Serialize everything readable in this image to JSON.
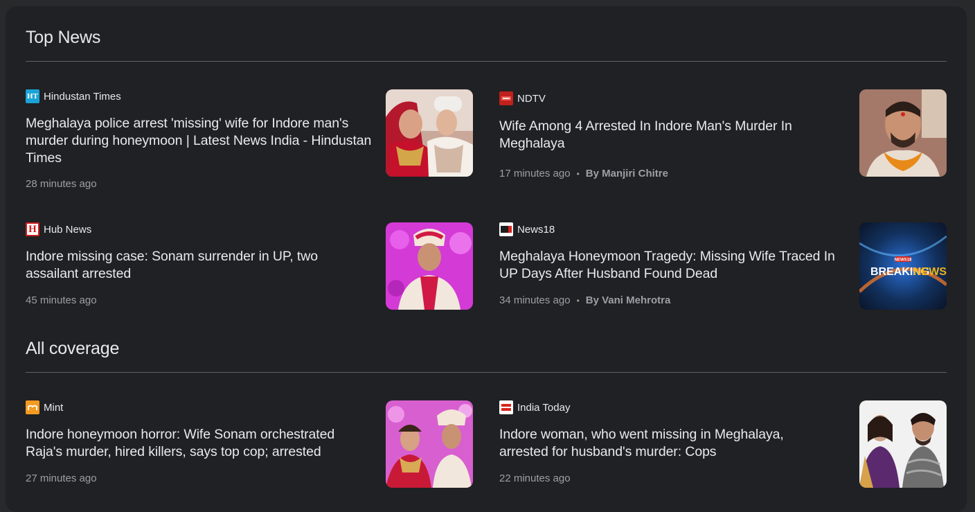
{
  "sections": {
    "top_news": {
      "title": "Top News"
    },
    "all_coverage": {
      "title": "All coverage"
    }
  },
  "articles": [
    {
      "source": "Hindustan Times",
      "favicon": "ht-icon",
      "headline": "Meghalaya police arrest 'missing' wife for Indore man's murder during honeymoon | Latest News India - Hindustan Times",
      "time": "28 minutes ago",
      "author": ""
    },
    {
      "source": "NDTV",
      "favicon": "ndtv-icon",
      "headline": "Wife Among 4 Arrested In Indore Man's Murder In Meghalaya",
      "time": "17 minutes ago",
      "author": "By Manjiri Chitre"
    },
    {
      "source": "Hub News",
      "favicon": "hub-news-icon",
      "headline": "Indore missing case: Sonam surrender in UP, two assailant arrested",
      "time": "45 minutes ago",
      "author": ""
    },
    {
      "source": "News18",
      "favicon": "news18-icon",
      "headline": "Meghalaya Honeymoon Tragedy: Missing Wife Traced In UP Days After Husband Found Dead",
      "time": "34 minutes ago",
      "author": "By Vani Mehrotra",
      "thumb_text": {
        "line1": "BREAKING",
        "line2": "NEWS",
        "badge": "NEWS18"
      }
    },
    {
      "source": "Mint",
      "favicon": "mint-icon",
      "headline": "Indore honeymoon horror: Wife Sonam orchestrated Raja's murder, hired killers, says top cop; arrested",
      "time": "27 minutes ago",
      "author": ""
    },
    {
      "source": "India Today",
      "favicon": "india-today-icon",
      "headline": "Indore woman, who went missing in Meghalaya, arrested for husband's murder: Cops",
      "time": "22 minutes ago",
      "author": ""
    }
  ],
  "favicon_text": {
    "ht": "HT",
    "hub": "H"
  },
  "colors": {
    "background": "#202124",
    "text": "#e8eaed",
    "muted": "#9aa0a6",
    "divider": "#5f6368"
  }
}
